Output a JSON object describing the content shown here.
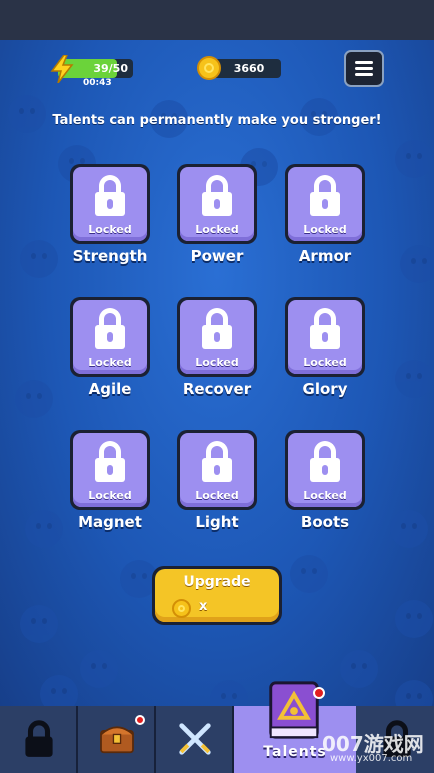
{
  "status": {
    "energy": "39/50",
    "energy_fraction": 0.78,
    "timer": "00:43",
    "coins": "3660"
  },
  "subtitle": "Talents can permanently make you stronger!",
  "talents": [
    {
      "name": "Strength",
      "state": "Locked"
    },
    {
      "name": "Power",
      "state": "Locked"
    },
    {
      "name": "Armor",
      "state": "Locked"
    },
    {
      "name": "Agile",
      "state": "Locked"
    },
    {
      "name": "Recover",
      "state": "Locked"
    },
    {
      "name": "Glory",
      "state": "Locked"
    },
    {
      "name": "Magnet",
      "state": "Locked"
    },
    {
      "name": "Light",
      "state": "Locked"
    },
    {
      "name": "Boots",
      "state": "Locked"
    }
  ],
  "upgrade": {
    "label": "Upgrade",
    "cost": "x"
  },
  "nav": {
    "active_label": "Talents",
    "items": [
      "lock-icon",
      "treasure-chest-icon",
      "crossed-swords-icon",
      "spellbook-icon",
      "lock-icon"
    ]
  },
  "watermark": {
    "main": "007游戏网",
    "sub": "www.yx007.com"
  },
  "colors": {
    "card": "#9d8ff0",
    "button": "#f4c526",
    "energy": "#6bd33a",
    "background": "#1d57b5"
  }
}
